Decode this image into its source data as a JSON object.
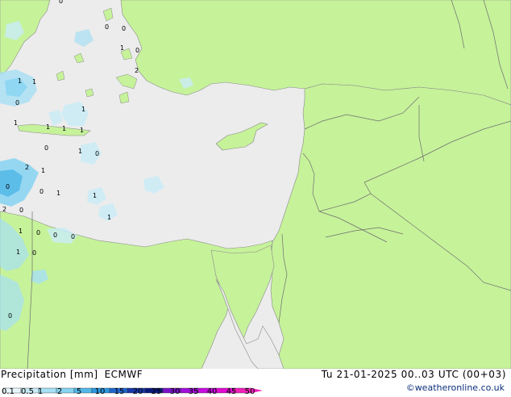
{
  "title": "Precipitation [mm]",
  "model": "ECMWF",
  "datetime": "Tu 21-01-2025 00..03 UTC (00+03)",
  "credit": "©weatheronline.co.uk",
  "legend": {
    "labels": [
      "0.1",
      "0.5",
      "1",
      "2",
      "5",
      "10",
      "15",
      "20",
      "25",
      "30",
      "35",
      "40",
      "45",
      "50"
    ],
    "colors": [
      "#e6f6fc",
      "#c8ecf8",
      "#a6e0f5",
      "#86d4f2",
      "#52b8e8",
      "#2c98e0",
      "#1f66cc",
      "#1838a8",
      "#0a1a7a",
      "#7a12c8",
      "#a010d8",
      "#c80ce0",
      "#e00ad0",
      "#f020b8"
    ]
  },
  "map_labels": [
    "0",
    "0",
    "0",
    "1",
    "0",
    "2",
    "1",
    "1",
    "0",
    "1",
    "1",
    "1",
    "1",
    "1",
    "0",
    "1",
    "0",
    "2",
    "1",
    "0",
    "0",
    "1",
    "1",
    "2",
    "0",
    "1",
    "1",
    "0",
    "0",
    "0",
    "1",
    "0",
    "0"
  ],
  "colors": {
    "land": "#c6f29a",
    "sea": "#ececec",
    "border": "#6e6e6e"
  }
}
